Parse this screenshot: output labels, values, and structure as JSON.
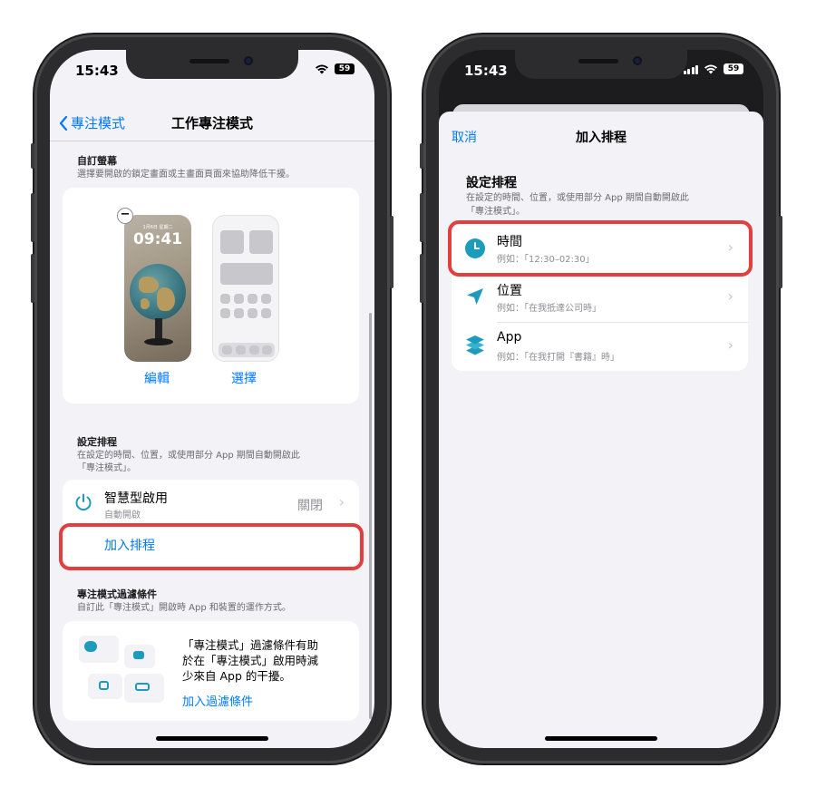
{
  "colors": {
    "accent": "#007aff",
    "highlight": "#e2403f",
    "icon_teal": "#1c9bbd"
  },
  "left": {
    "status": {
      "time": "15:43",
      "battery": "59"
    },
    "nav": {
      "back_label": "專注模式",
      "title": "工作專注模式"
    },
    "custom_screen": {
      "title": "自訂螢幕",
      "desc": "選擇要開啟的鎖定畫面或主畫面頁面來協助降低干擾。",
      "lock_date": "1月6日 星期二",
      "lock_time": "09:41",
      "edit_label": "編輯",
      "choose_label": "選擇"
    },
    "schedule": {
      "title": "設定排程",
      "desc_line1": "在設定的時間、位置，或使用部分 App 期間自動開啟此",
      "desc_line2": "「專注模式」。",
      "smart_title": "智慧型啟用",
      "smart_sub": "自動開啟",
      "smart_value": "關閉",
      "add_schedule": "加入排程"
    },
    "filters": {
      "title": "專注模式過濾條件",
      "desc": "自訂此「專注模式」開啟時 App 和裝置的運作方式。",
      "text_line1": "「專注模式」過濾條件有助",
      "text_line2": "於在「專注模式」啟用時減",
      "text_line3": "少來自 App 的干擾。",
      "add_filter": "加入過濾條件"
    }
  },
  "right": {
    "status": {
      "time": "15:43",
      "battery": "59"
    },
    "sheet": {
      "cancel": "取消",
      "title": "加入排程",
      "section_title": "設定排程",
      "desc_line1": "在設定的時間、位置，或使用部分 App 期間自動開啟此",
      "desc_line2": "「專注模式」。",
      "rows": [
        {
          "title": "時間",
          "sub": "例如：「12:30–02:30」",
          "icon": "clock-icon"
        },
        {
          "title": "位置",
          "sub": "例如：「在我抵達公司時」",
          "icon": "location-arrow-icon"
        },
        {
          "title": "App",
          "sub": "例如：「在我打開『書籍』時」",
          "icon": "app-stack-icon"
        }
      ]
    }
  }
}
